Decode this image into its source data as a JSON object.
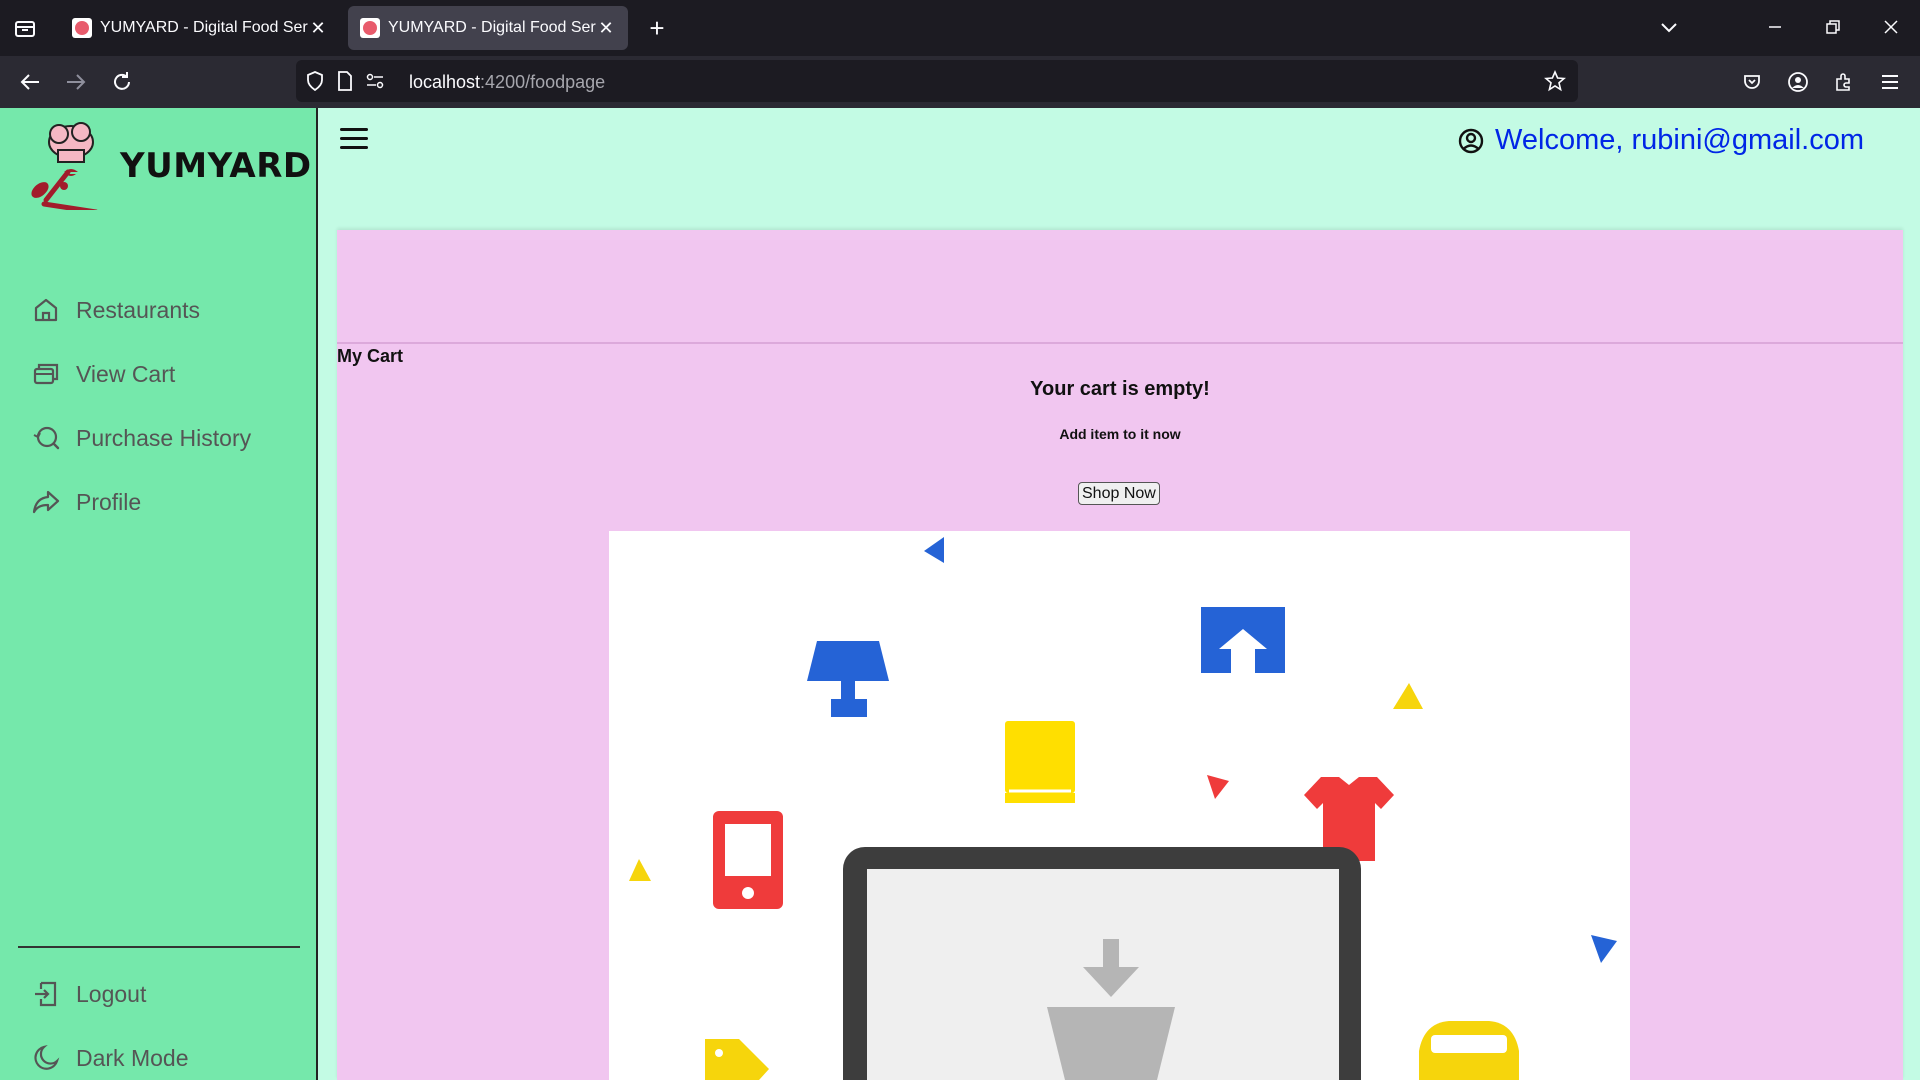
{
  "browser": {
    "tabs": [
      {
        "title": "YUMYARD - Digital Food Service"
      },
      {
        "title": "YUMYARD - Digital Food Service"
      }
    ],
    "url_host": "localhost",
    "url_path": ":4200/foodpage"
  },
  "sidebar": {
    "brand": "YUMYARD",
    "items": [
      {
        "label": "Restaurants",
        "icon": "home-icon"
      },
      {
        "label": "View Cart",
        "icon": "cart-cards-icon"
      },
      {
        "label": "Purchase History",
        "icon": "search-history-icon"
      },
      {
        "label": "Profile",
        "icon": "share-arrow-icon"
      }
    ],
    "bottom_items": [
      {
        "label": "Logout",
        "icon": "logout-icon"
      },
      {
        "label": "Dark Mode",
        "icon": "moon-icon"
      }
    ]
  },
  "header": {
    "welcome": "Welcome, rubini@gmail.com"
  },
  "cart": {
    "title": "My Cart",
    "empty_title": "Your cart is empty!",
    "empty_subtitle": "Add item to it now",
    "shop_button": "Shop Now"
  },
  "colors": {
    "sidebar_bg": "#75e8ab",
    "header_bg": "#c3fbe4",
    "panel_bg": "#f1c6f0",
    "welcome_text": "#0026e6"
  }
}
